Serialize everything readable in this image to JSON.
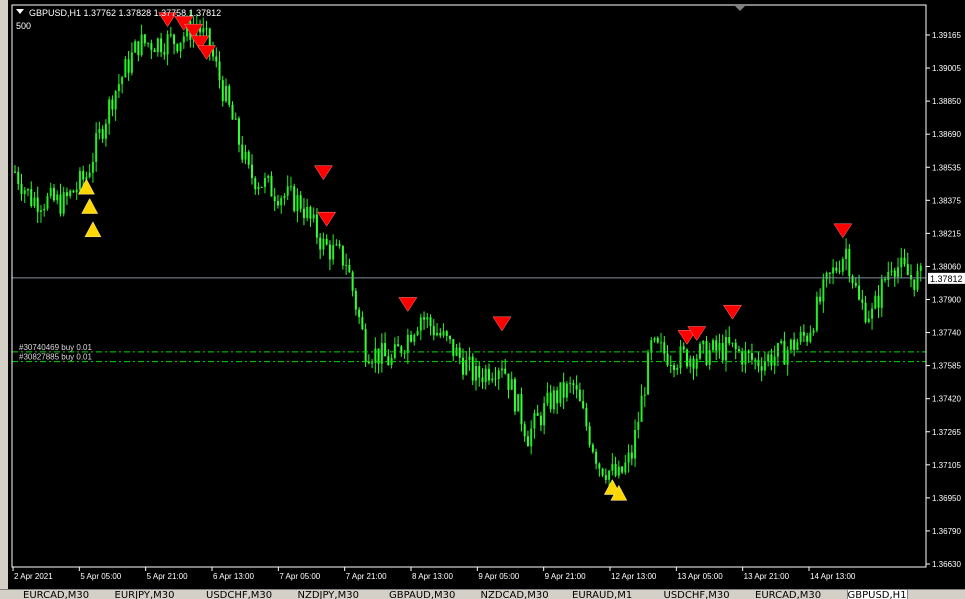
{
  "header": {
    "symbol_line": "GBPUSD,H1  1.37762 1.37828 1.37758 1.37812",
    "volume_label": "500"
  },
  "colors": {
    "background": "#000000",
    "bull_bar": "#22ee22",
    "bear_bar": "#33ff33",
    "axis_text": "#ffffff",
    "sell_arrow": "#ff0000",
    "buy_arrow": "#ffd700",
    "order_line": "#00dd00",
    "price_line": "#8090a0"
  },
  "orders": [
    {
      "label": "#30740469 buy 0.01",
      "price": 1.3743
    },
    {
      "label": "#30827885 buy 0.01",
      "price": 1.3738
    }
  ],
  "tabs": [
    "EURCAD,M30",
    "EURJPY,M30",
    "USDCHF,M30",
    "NZDJPY,M30",
    "GBPAUD,M30",
    "NZDCAD,M30",
    "EURAUD,M1",
    "USDCHF,M30",
    "EURCAD,M30",
    "GBPUSD,H1"
  ],
  "chart_data": {
    "type": "candlestick",
    "symbol": "GBPUSD",
    "timeframe": "H1",
    "title": "GBPUSD,H1",
    "current_price": 1.37812,
    "ylim": [
      1.3632,
      1.3922
    ],
    "y_ticks": [
      "1.39165",
      "1.39005",
      "1.38850",
      "1.38690",
      "1.38535",
      "1.38375",
      "1.38215",
      "1.38060",
      "1.37900",
      "1.37740",
      "1.37585",
      "1.37420",
      "1.37265",
      "1.37105",
      "1.36950",
      "1.36790",
      "1.36630"
    ],
    "x_ticks": [
      "2 Apr 2021",
      "5 Apr 05:00",
      "5 Apr 21:00",
      "6 Apr 13:00",
      "7 Apr 05:00",
      "7 Apr 21:00",
      "8 Apr 13:00",
      "9 Apr 05:00",
      "9 Apr 21:00",
      "12 Apr 13:00",
      "13 Apr 05:00",
      "13 Apr 21:00",
      "14 Apr 13:00"
    ],
    "close_path": [
      {
        "bar": 0,
        "price": 1.3836
      },
      {
        "bar": 5,
        "price": 1.3822
      },
      {
        "bar": 15,
        "price": 1.382
      },
      {
        "bar": 22,
        "price": 1.3834
      },
      {
        "bar": 30,
        "price": 1.3875
      },
      {
        "bar": 38,
        "price": 1.3902
      },
      {
        "bar": 50,
        "price": 1.3904
      },
      {
        "bar": 56,
        "price": 1.3912
      },
      {
        "bar": 60,
        "price": 1.39
      },
      {
        "bar": 66,
        "price": 1.3868
      },
      {
        "bar": 72,
        "price": 1.3835
      },
      {
        "bar": 80,
        "price": 1.3826
      },
      {
        "bar": 88,
        "price": 1.382
      },
      {
        "bar": 95,
        "price": 1.3798
      },
      {
        "bar": 102,
        "price": 1.379
      },
      {
        "bar": 108,
        "price": 1.3745
      },
      {
        "bar": 116,
        "price": 1.3738
      },
      {
        "bar": 125,
        "price": 1.3762
      },
      {
        "bar": 133,
        "price": 1.3748
      },
      {
        "bar": 142,
        "price": 1.373
      },
      {
        "bar": 150,
        "price": 1.3738
      },
      {
        "bar": 158,
        "price": 1.37
      },
      {
        "bar": 165,
        "price": 1.3718
      },
      {
        "bar": 172,
        "price": 1.3725
      },
      {
        "bar": 180,
        "price": 1.3685
      },
      {
        "bar": 186,
        "price": 1.3678
      },
      {
        "bar": 190,
        "price": 1.369
      },
      {
        "bar": 196,
        "price": 1.3745
      },
      {
        "bar": 204,
        "price": 1.374
      },
      {
        "bar": 212,
        "price": 1.3742
      },
      {
        "bar": 220,
        "price": 1.3745
      },
      {
        "bar": 228,
        "price": 1.3738
      },
      {
        "bar": 236,
        "price": 1.3742
      },
      {
        "bar": 244,
        "price": 1.3752
      },
      {
        "bar": 250,
        "price": 1.3778
      },
      {
        "bar": 256,
        "price": 1.3796
      },
      {
        "bar": 260,
        "price": 1.3768
      },
      {
        "bar": 264,
        "price": 1.3762
      },
      {
        "bar": 270,
        "price": 1.379
      },
      {
        "bar": 276,
        "price": 1.3781
      }
    ],
    "sell_signals": [
      {
        "bar": 47,
        "price": 1.3915
      },
      {
        "bar": 52,
        "price": 1.3913
      },
      {
        "bar": 55,
        "price": 1.3909
      },
      {
        "bar": 57,
        "price": 1.3903
      },
      {
        "bar": 59,
        "price": 1.3898
      },
      {
        "bar": 95,
        "price": 1.3836
      },
      {
        "bar": 96,
        "price": 1.3812
      },
      {
        "bar": 121,
        "price": 1.3768
      },
      {
        "bar": 150,
        "price": 1.3758
      },
      {
        "bar": 207,
        "price": 1.3751
      },
      {
        "bar": 210,
        "price": 1.3753
      },
      {
        "bar": 221,
        "price": 1.3764
      },
      {
        "bar": 255,
        "price": 1.3806
      }
    ],
    "buy_signals": [
      {
        "bar": 22,
        "price": 1.3828
      },
      {
        "bar": 23,
        "price": 1.3818
      },
      {
        "bar": 24,
        "price": 1.3806
      },
      {
        "bar": 184,
        "price": 1.3673
      },
      {
        "bar": 186,
        "price": 1.367
      }
    ]
  }
}
